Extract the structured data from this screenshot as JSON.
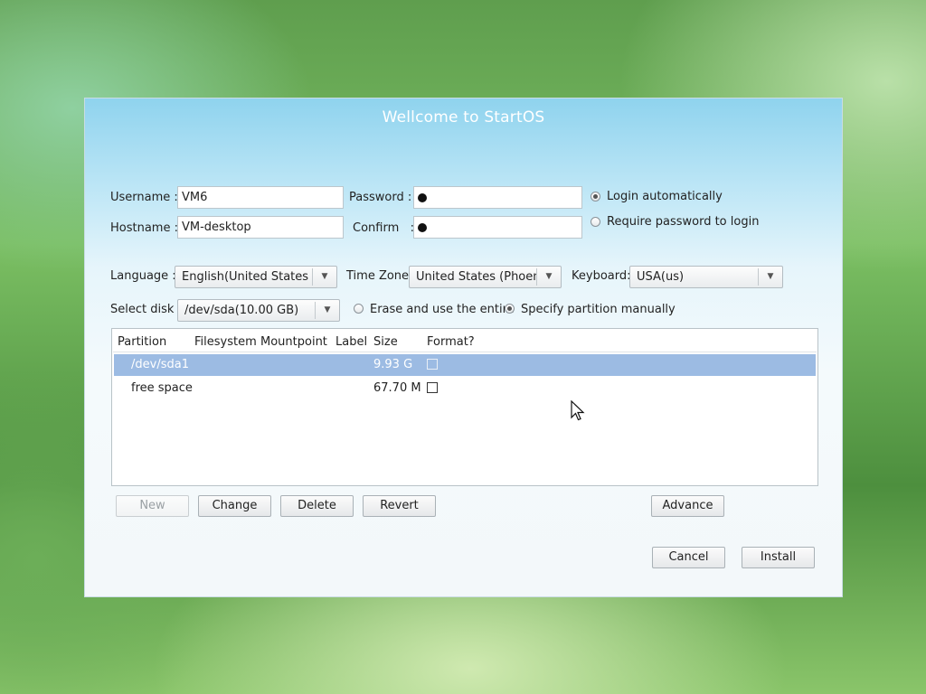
{
  "window": {
    "title": "Wellcome to StartOS"
  },
  "account": {
    "username_label": "Username :",
    "username_value": "VM6",
    "hostname_label": "Hostname :",
    "hostname_value": "VM-desktop",
    "password_label": "Password :",
    "confirm_label": "Confirm   :",
    "login_auto_label": "Login automatically",
    "login_auto_selected": true,
    "require_password_label": "Require password to login",
    "require_password_selected": false
  },
  "locale": {
    "language_label": "Language :",
    "language_value": "English(United States)",
    "timezone_label": "Time Zone:",
    "timezone_value": "United States (Phoenix)",
    "keyboard_label": "Keyboard:",
    "keyboard_value": "USA(us)"
  },
  "disk": {
    "select_label": "Select disk :",
    "select_value": "/dev/sda(10.00 GB)",
    "erase_label": "Erase and use the entire",
    "erase_selected": false,
    "manual_label": "Specify partition manually",
    "manual_selected": true
  },
  "partitions": {
    "columns": [
      "Partition",
      "Filesystem",
      "Mountpoint",
      "Label",
      "Size",
      "Format?"
    ],
    "rows": [
      {
        "partition": "/dev/sda1",
        "filesystem": "",
        "mountpoint": "",
        "label": "",
        "size": "9.93 G",
        "format": false,
        "selected": true
      },
      {
        "partition": "free space",
        "filesystem": "",
        "mountpoint": "",
        "label": "",
        "size": "67.70 M",
        "format": false,
        "selected": false
      }
    ]
  },
  "buttons": {
    "new": "New",
    "change": "Change",
    "delete": "Delete",
    "revert": "Revert",
    "advance": "Advance",
    "cancel": "Cancel",
    "install": "Install"
  }
}
